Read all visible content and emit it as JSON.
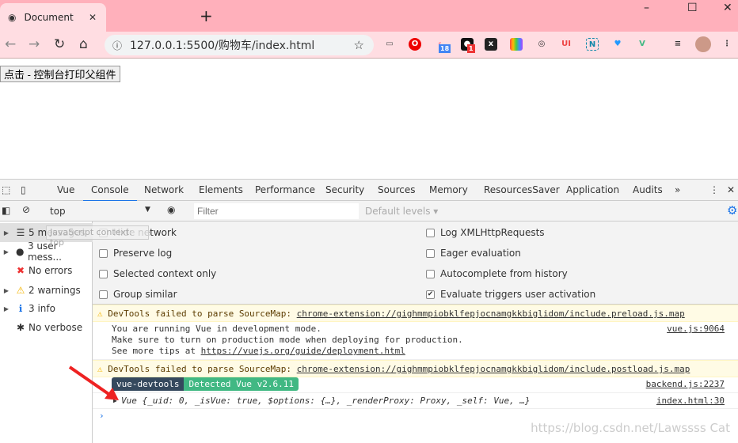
{
  "browser": {
    "tab_title": "Document",
    "url": "127.0.0.1:5500/购物车/index.html",
    "ext_badges": [
      "18",
      "1"
    ]
  },
  "page": {
    "button_label": "点击 - 控制台打印父组件"
  },
  "devtools": {
    "tabs": [
      "Vue",
      "Console",
      "Network",
      "Elements",
      "Performance",
      "Security",
      "Sources",
      "Memory",
      "ResourcesSaver",
      "Application",
      "Audits"
    ],
    "active_tab": "Console",
    "context": "top",
    "filter_placeholder": "Filter",
    "levels": "Default levels ▾",
    "sidebar": [
      {
        "label": "5 messages",
        "icon": "list-icon"
      },
      {
        "label": "3 user mess...",
        "icon": "user-icon"
      },
      {
        "label": "No errors",
        "icon": "error-icon"
      },
      {
        "label": "2 warnings",
        "icon": "warning-icon"
      },
      {
        "label": "3 info",
        "icon": "info-icon"
      },
      {
        "label": "No verbose",
        "icon": "bug-icon"
      }
    ],
    "tooltip": "JavaScript context: top",
    "settings_left": [
      {
        "label": "Hide network",
        "checked": false
      },
      {
        "label": "Preserve log",
        "checked": false
      },
      {
        "label": "Selected context only",
        "checked": false
      },
      {
        "label": "Group similar",
        "checked": false
      }
    ],
    "settings_right": [
      {
        "label": "Log XMLHttpRequests",
        "checked": false
      },
      {
        "label": "Eager evaluation",
        "checked": false
      },
      {
        "label": "Autocomplete from history",
        "checked": false
      },
      {
        "label": "Evaluate triggers user activation",
        "checked": true
      }
    ],
    "messages": {
      "w1_text": "DevTools failed to parse SourceMap: ",
      "w1_link": "chrome-extension://gighmmpiobklfepjocnamgkkbiglidom/include.preload.js.map",
      "vue_l1": "You are running Vue in development mode.",
      "vue_l2": "Make sure to turn on production mode when deploying for production.",
      "vue_l3": "See more tips at ",
      "vue_link": "https://vuejs.org/guide/deployment.html",
      "vue_src": "vue.js:9064",
      "w2_text": "DevTools failed to parse SourceMap: ",
      "w2_link": "chrome-extension://gighmmpiobklfepjocnamgkkbiglidom/include.postload.js.map",
      "badge1": "vue-devtools",
      "badge2": "Detected Vue v2.6.11",
      "badge_src": "backend.js:2237",
      "obj": "Vue {_uid: 0, _isVue: true, $options: {…}, _renderProxy: Proxy, _self: Vue, …}",
      "obj_src": "index.html:30"
    }
  },
  "watermark": "https://blog.csdn.net/Lawssss Cat"
}
